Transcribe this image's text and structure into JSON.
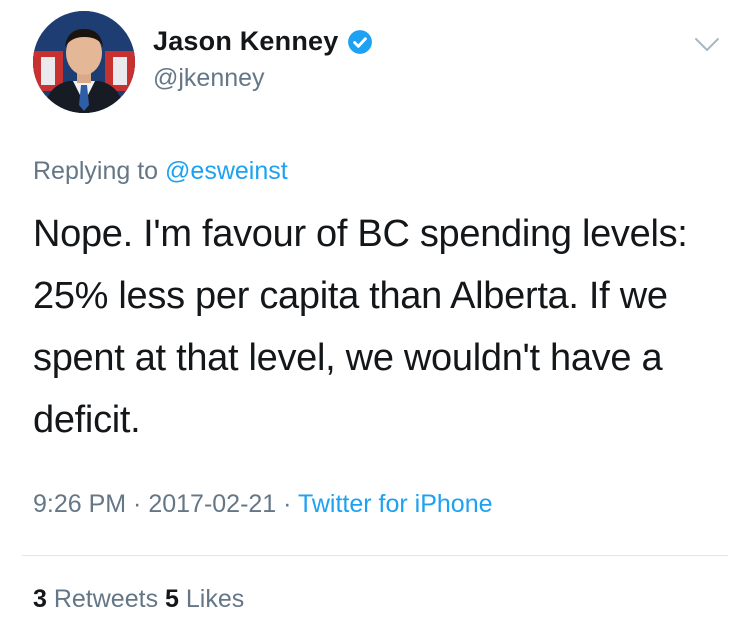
{
  "author": {
    "name": "Jason Kenney",
    "handle": "@jkenney",
    "verified_icon": "verified-badge-icon"
  },
  "reply": {
    "prefix": "Replying to ",
    "mention": "@esweinst"
  },
  "tweet": {
    "text": "Nope. I'm favour of BC spending levels: 25% less per capita than Alberta. If we spent at that level, we wouldn't have a deficit."
  },
  "meta": {
    "time": "9:26 PM",
    "sep1": " · ",
    "date": "2017-02-21",
    "sep2": " · ",
    "source": "Twitter for iPhone"
  },
  "stats": {
    "retweets_count": "3",
    "retweets_label": " Retweets ",
    "likes_count": "5",
    "likes_label": " Likes"
  },
  "colors": {
    "text": "#14171a",
    "secondary": "#657786",
    "link": "#1da1f2",
    "divider": "#e1e8ed"
  }
}
